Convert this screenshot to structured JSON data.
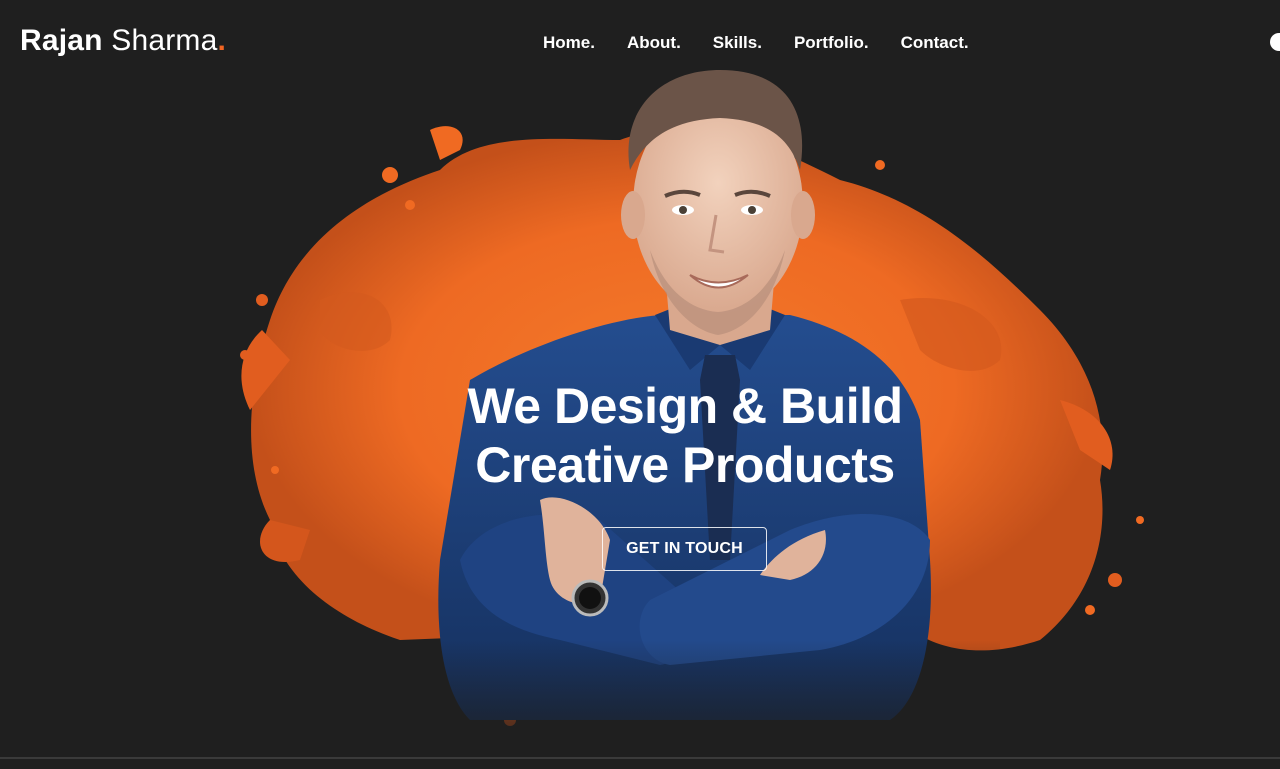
{
  "header": {
    "logo_first": "Rajan",
    "logo_last": "Sharma",
    "logo_dot": ".",
    "nav": [
      {
        "label": "Home",
        "dot": "."
      },
      {
        "label": "About",
        "dot": "."
      },
      {
        "label": "Skills",
        "dot": "."
      },
      {
        "label": "Portfolio",
        "dot": "."
      },
      {
        "label": "Contact",
        "dot": "."
      }
    ]
  },
  "hero": {
    "headline_line1": "We Design & Build",
    "headline_line2": "Creative Products",
    "cta_label": "GET IN TOUCH",
    "image_icon": "person-portrait-icon"
  },
  "colors": {
    "background": "#1f1f1f",
    "accent": "#f26522",
    "shirt": "#1f3f7a",
    "text": "#ffffff"
  }
}
